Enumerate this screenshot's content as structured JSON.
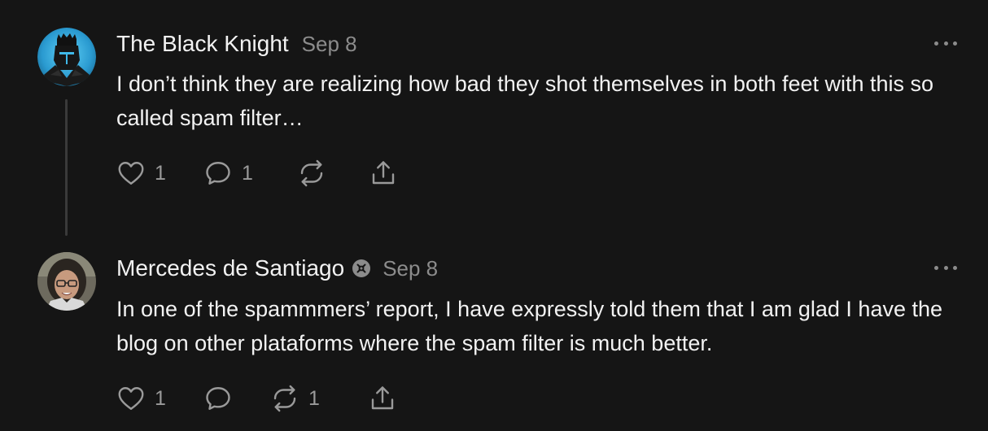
{
  "comments": [
    {
      "author": "The Black Knight",
      "date": "Sep 8",
      "text": "I don’t think they are realizing how bad they shot themselves in both feet with this so called spam filter…",
      "likes": "1",
      "replies": "1",
      "restacks": "",
      "avatar_icon": "black-knight-avatar",
      "has_badge": false
    },
    {
      "author": "Mercedes de Santiago",
      "date": "Sep 8",
      "text": "In one of the spammmers’ report, I have expressly told them that I am glad I have the blog on other plataforms where the spam filter is much better.",
      "likes": "1",
      "replies": "",
      "restacks": "1",
      "avatar_icon": "woman-with-glasses-avatar",
      "has_badge": true
    }
  ],
  "colors": {
    "background": "#151515",
    "text_primary": "#f2f2f2",
    "text_secondary": "#8c8c8c",
    "icon": "#9a9a9a",
    "thread_line": "#3a3a3a"
  }
}
